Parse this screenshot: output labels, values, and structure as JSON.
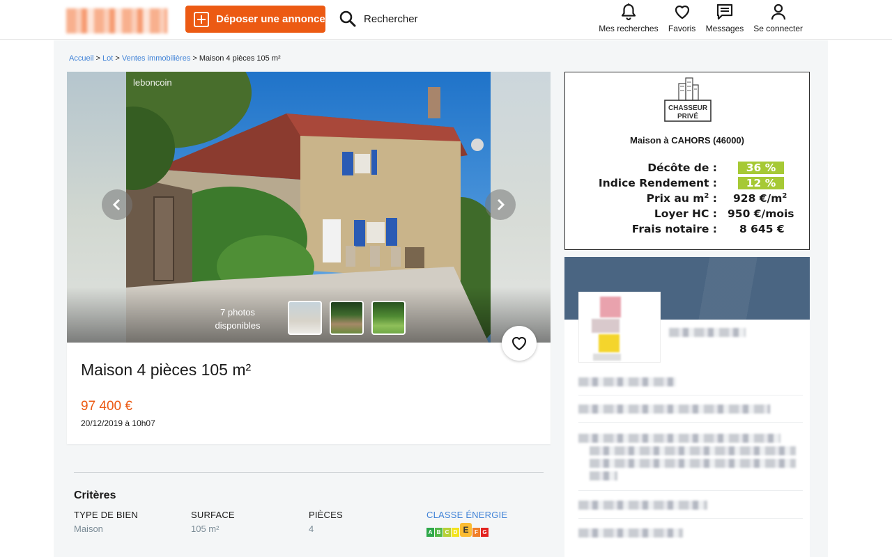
{
  "header": {
    "post_ad_label": "Déposer une annonce",
    "search_label": "Rechercher",
    "nav": [
      {
        "label": "Mes recherches",
        "icon": "bell-icon"
      },
      {
        "label": "Favoris",
        "icon": "heart-icon"
      },
      {
        "label": "Messages",
        "icon": "message-icon"
      },
      {
        "label": "Se connecter",
        "icon": "user-icon"
      }
    ]
  },
  "breadcrumb": {
    "items": [
      "Accueil",
      "Lot",
      "Ventes immobilières"
    ],
    "current": "Maison 4 pièces 105 m²",
    "separator": ">"
  },
  "gallery": {
    "watermark": "leboncoin",
    "photo_count_line1": "7 photos",
    "photo_count_line2": "disponibles"
  },
  "ad": {
    "title": "Maison 4 pièces 105 m²",
    "price": "97 400 €",
    "date": "20/12/2019 à 10h07",
    "accent_color": "#ec5a13"
  },
  "criteria": {
    "title": "Critères",
    "items": [
      {
        "label": "TYPE DE BIEN",
        "value": "Maison"
      },
      {
        "label": "SURFACE",
        "value": "105 m²"
      },
      {
        "label": "PIÈCES",
        "value": "4"
      }
    ],
    "energy": {
      "label": "CLASSE ÉNERGIE",
      "classes": [
        "A",
        "B",
        "C",
        "D",
        "E",
        "F",
        "G"
      ],
      "active": "E",
      "colors": [
        "#2ea84a",
        "#54b848",
        "#b6d136",
        "#f3e31e",
        "#fbbc33",
        "#f07f2a",
        "#e2221f"
      ]
    }
  },
  "chasseur": {
    "logo_line1": "CHASSEUR",
    "logo_line2": "PRIVÉ",
    "subtitle": "Maison à CAHORS (46000)",
    "decote_label": "Décôte de :",
    "decote_value": "36 %",
    "rendement_label": "Indice Rendement :",
    "rendement_value": "12 %",
    "prix_label_main": "Prix au m",
    "prix_label_exp": "2",
    "prix_label_tail": " :",
    "prix_value_main": "928 €/m",
    "prix_value_exp": "2",
    "loyer_label": "Loyer HC :",
    "loyer_value": "950 €/mois",
    "frais_label": "Frais notaire :",
    "frais_value": "8 645 €",
    "highlight_color": "#a6c935"
  }
}
